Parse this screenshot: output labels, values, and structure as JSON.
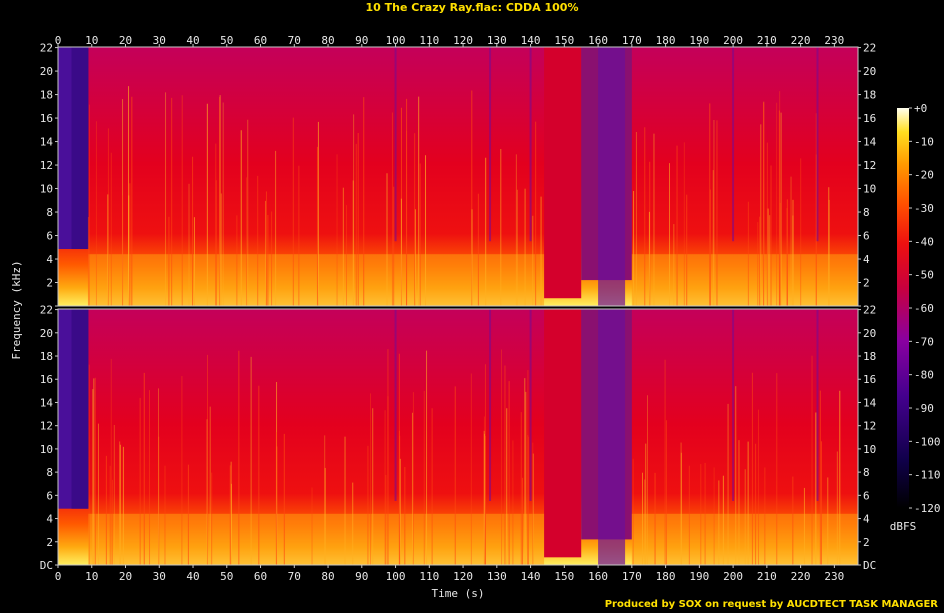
{
  "title": "10 The Crazy Ray.flac: CDDA 100%",
  "footer": "Produced by SOX on request by AUCDTECT TASK MANAGER",
  "chart_data": {
    "type": "heatmap",
    "title": "10 The Crazy Ray.flac: CDDA 100%",
    "xlabel": "Time (s)",
    "ylabel": "Frequency (kHz)",
    "xlim": [
      0,
      237
    ],
    "ylim": [
      0,
      22.05
    ],
    "x_ticks": [
      "0",
      "10",
      "20",
      "30",
      "40",
      "50",
      "60",
      "70",
      "80",
      "90",
      "100",
      "110",
      "120",
      "130",
      "140",
      "150",
      "160",
      "170",
      "180",
      "190",
      "200",
      "210",
      "220",
      "230"
    ],
    "y_ticks": [
      "DC",
      "2",
      "4",
      "6",
      "8",
      "10",
      "12",
      "14",
      "16",
      "18",
      "20",
      "22"
    ],
    "channels": 2,
    "colorbar": {
      "label": "dBFS",
      "ticks": [
        "+0",
        "-10",
        "-20",
        "-30",
        "-40",
        "-50",
        "-60",
        "-70",
        "-80",
        "-90",
        "-100",
        "-110",
        "-120"
      ],
      "range": [
        -120,
        0
      ]
    },
    "segments": [
      {
        "start": 0,
        "end": 9,
        "description": "quiet intro",
        "level_dbfs": -85
      },
      {
        "start": 9,
        "end": 144,
        "description": "full band",
        "level_dbfs": -55
      },
      {
        "start": 144,
        "end": 155,
        "description": "band limited",
        "level_dbfs": -60
      },
      {
        "start": 155,
        "end": 170,
        "description": "quiet section",
        "level_dbfs": -75
      },
      {
        "start": 170,
        "end": 237,
        "description": "full band",
        "level_dbfs": -55
      }
    ],
    "colors": {
      "text": "#ffe000",
      "axis": "#e8e8e8",
      "frame": "#c8c8c8"
    }
  }
}
